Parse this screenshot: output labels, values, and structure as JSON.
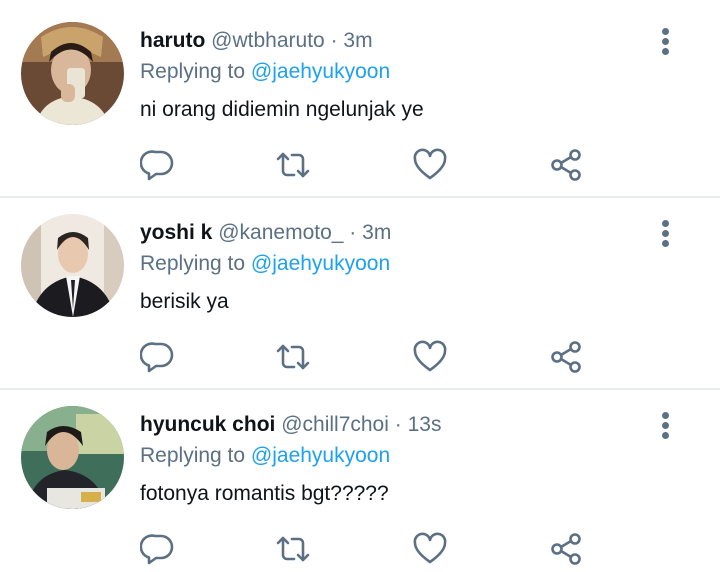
{
  "replies": [
    {
      "name": "haruto",
      "handle": "@wtbharuto",
      "separator": "·",
      "time": "3m",
      "replying_prefix": "Replying to",
      "replying_to": "@jaehyukyoon",
      "text": "ni orang didiemin ngelunjak ye"
    },
    {
      "name": "yoshi k",
      "handle": "@kanemoto_",
      "separator": "·",
      "time": "3m",
      "replying_prefix": "Replying to",
      "replying_to": "@jaehyukyoon",
      "text": "berisik ya"
    },
    {
      "name": "hyuncuk choi",
      "handle": "@chill7choi",
      "separator": "·",
      "time": "13s",
      "replying_prefix": "Replying to",
      "replying_to": "@jaehyukyoon",
      "text": "fotonya romantis bgt?????"
    }
  ],
  "icons": {
    "reply": "comment-icon",
    "retweet": "retweet-icon",
    "like": "heart-icon",
    "share": "share-icon",
    "more": "more-vertical-icon"
  },
  "colors": {
    "secondary_text": "#5b7083",
    "mention": "#1da1f2",
    "divider": "#e6ecf0"
  }
}
